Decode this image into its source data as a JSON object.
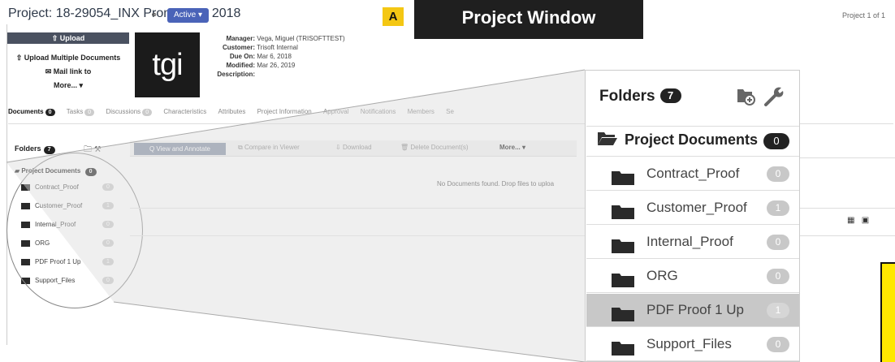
{
  "header": {
    "project_label": "Project:",
    "project_name": "18-29054_INX Promo Bag 2018",
    "status": "Active ▾",
    "badge": "A",
    "banner": "Project Window",
    "pager": "Project 1 of 1"
  },
  "actions": {
    "upload": "⇧ Upload",
    "upload_multiple": "⇧ Upload Multiple Documents",
    "mail_link": "✉ Mail link to",
    "more": "More... ▾"
  },
  "logo_text": "tgi",
  "meta": {
    "manager_label": "Manager:",
    "manager": "Vega, Miguel (TRISOFTTEST)",
    "customer_label": "Customer:",
    "customer": "Trisoft Internal",
    "due_label": "Due On:",
    "due": "Mar 6, 2018",
    "modified_label": "Modified:",
    "modified": "Mar 26, 2019",
    "description_label": "Description:"
  },
  "tabs": [
    {
      "label": "Documents",
      "count": "0"
    },
    {
      "label": "Tasks",
      "count": "0"
    },
    {
      "label": "Discussions",
      "count": "0"
    },
    {
      "label": "Characteristics"
    },
    {
      "label": "Attributes"
    },
    {
      "label": "Project Information"
    },
    {
      "label": "Approval"
    },
    {
      "label": "Notifications"
    },
    {
      "label": "Members"
    },
    {
      "label": "Se"
    }
  ],
  "small_panel": {
    "title": "Folders",
    "count": "7",
    "root": "Project Documents",
    "root_count": "0"
  },
  "toolbar": {
    "view": "Q View and Annotate",
    "compare": "Compare in Viewer",
    "download": "Download",
    "delete": "Delete Document(s)",
    "more": "More... ▾"
  },
  "empty_message": "No Documents found. Drop files to uploa",
  "zoom_panel": {
    "title": "Folders",
    "count": "7",
    "root": "Project Documents",
    "root_count": "0"
  },
  "folders": [
    {
      "name": "Contract_Proof",
      "count": "0"
    },
    {
      "name": "Customer_Proof",
      "count": "1"
    },
    {
      "name": "Internal_Proof",
      "count": "0"
    },
    {
      "name": "ORG",
      "count": "0"
    },
    {
      "name": "PDF Proof 1 Up",
      "count": "1",
      "selected": true
    },
    {
      "name": "Support_Files",
      "count": "0"
    }
  ],
  "colors": {
    "accent_blue": "#4a63b8",
    "badge_yellow": "#f4c713",
    "callout_yellow": "#ffe800",
    "banner_black": "#1f1f1f"
  }
}
